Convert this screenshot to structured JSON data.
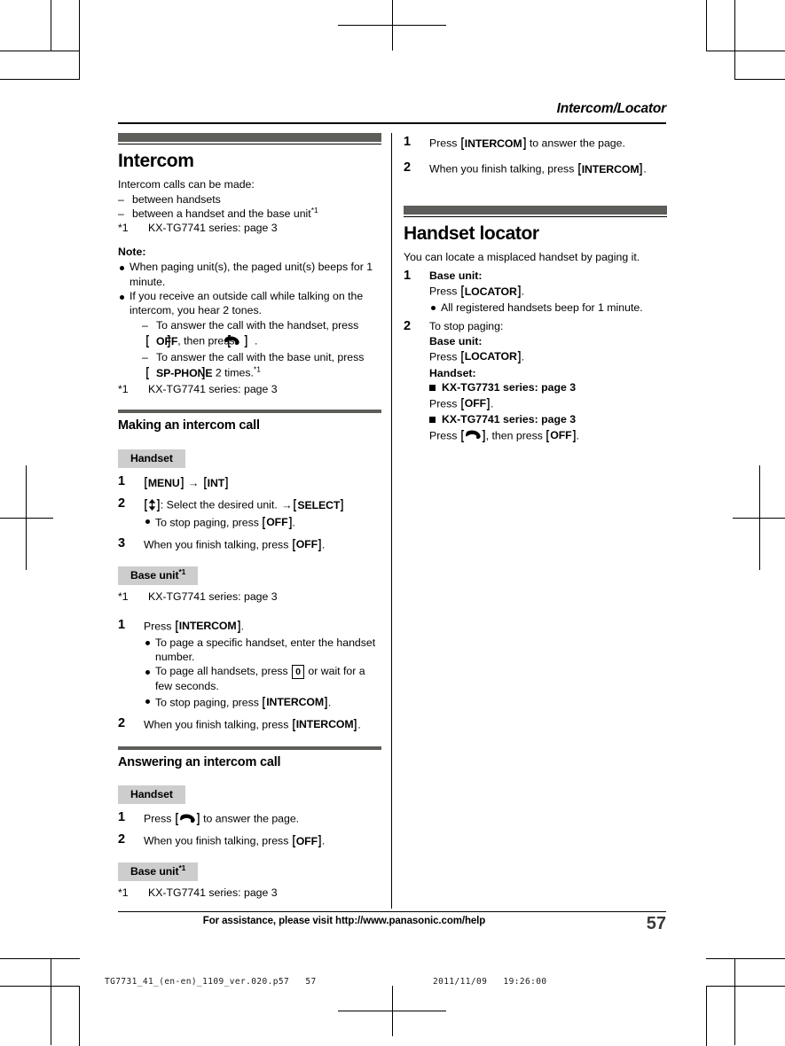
{
  "runningHead": "Intercom/Locator",
  "footer": {
    "assistance": "For assistance, please visit http://www.panasonic.com/help",
    "pageNumber": "57"
  },
  "slug": {
    "left": "TG7731_41_(en-en)_1109_ver.020.p57   57",
    "right": "2011/11/09   19:26:00"
  },
  "leftColumn": {
    "intercom": {
      "title": "Intercom",
      "intro": "Intercom calls can be made:",
      "dashItems": [
        "between handsets",
        "between a handset and the base unit"
      ],
      "dashItem2Sup": "*1",
      "footnote": {
        "mark": "*1",
        "text": "KX-TG7741 series: page 3"
      },
      "noteLabel": "Note:",
      "bullets": [
        "When paging unit(s), the paged unit(s) beeps for 1 minute.",
        "If you receive an outside call while talking on the intercom, you hear 2 tones."
      ],
      "subDashes": [
        {
          "pre": "To answer the call with the handset, press ",
          "key1": "OFF",
          "mid": ", then press ",
          "keyGlyph": "talk-key",
          "post": "."
        },
        {
          "pre": "To answer the call with the base unit, press ",
          "key1": "SP-PHONE",
          "mid": " 2 times.",
          "sup": "*1"
        }
      ],
      "footnote2": {
        "mark": "*1",
        "text": "KX-TG7741 series: page 3"
      }
    },
    "making": {
      "title": "Making an intercom call",
      "handsetTag": "Handset",
      "handsetSteps": [
        {
          "num": "1",
          "keyA": "MENU",
          "arrow": "→",
          "keyB": "INT"
        },
        {
          "num": "2",
          "pre": ": Select the desired unit. ",
          "arrow": "→",
          "keyB": "SELECT",
          "bullet": {
            "pre": "To stop paging, press ",
            "key": "OFF",
            "post": "."
          }
        },
        {
          "num": "3",
          "pre": "When you finish talking, press ",
          "key": "OFF",
          "post": "."
        }
      ],
      "baseTag": "Base unit",
      "baseTagSup": "*1",
      "baseFootnote": {
        "mark": "*1",
        "text": "KX-TG7741 series: page 3"
      },
      "baseSteps": [
        {
          "num": "1",
          "pre": "Press ",
          "key": "INTERCOM",
          "post": ".",
          "bullets": [
            {
              "text": "To page a specific handset, enter the handset number."
            },
            {
              "pre": "To page all handsets, press ",
              "keybox": "0",
              "post": " or wait for a few seconds."
            },
            {
              "pre": "To stop paging, press ",
              "key": "INTERCOM",
              "post": "."
            }
          ]
        },
        {
          "num": "2",
          "pre": "When you finish talking, press ",
          "key": "INTERCOM",
          "post": "."
        }
      ]
    },
    "answering": {
      "title": "Answering an intercom call",
      "handsetTag": "Handset",
      "steps": [
        {
          "num": "1",
          "pre": "Press ",
          "keyGlyph": "talk-key",
          "post": " to answer the page."
        },
        {
          "num": "2",
          "pre": "When you finish talking, press ",
          "key": "OFF",
          "post": "."
        }
      ],
      "baseTag": "Base unit",
      "baseTagSup": "*1",
      "baseFootnote": {
        "mark": "*1",
        "text": "KX-TG7741 series: page 3"
      }
    }
  },
  "rightColumn": {
    "answeringCont": {
      "steps": [
        {
          "num": "1",
          "pre": "Press ",
          "key": "INTERCOM",
          "post": " to answer the page."
        },
        {
          "num": "2",
          "pre": "When you finish talking, press ",
          "key": "INTERCOM",
          "post": "."
        }
      ]
    },
    "locator": {
      "title": "Handset locator",
      "intro": "You can locate a misplaced handset by paging it.",
      "steps": [
        {
          "num": "1",
          "label": "Base unit:",
          "pre": "Press ",
          "key": "LOCATOR",
          "post": ".",
          "bullet": "All registered handsets beep for 1 minute."
        },
        {
          "num": "2",
          "line1": "To stop paging:",
          "label1": "Base unit:",
          "pre1": "Press ",
          "key1": "LOCATOR",
          "post1": ".",
          "label2": "Handset:",
          "series1": "KX-TG7731 series: page 3",
          "pre2": "Press ",
          "key2": "OFF",
          "post2": ".",
          "series2": "KX-TG7741 series: page 3",
          "pre3": "Press ",
          "keyGlyph3": "talk-key",
          "mid3": ", then press ",
          "key3": "OFF",
          "post3": "."
        }
      ]
    }
  },
  "colors": {
    "sectionBar": "#5d5d5a",
    "tagBackground": "#cdcdcd",
    "pageNumber": "#3a3a3a"
  }
}
